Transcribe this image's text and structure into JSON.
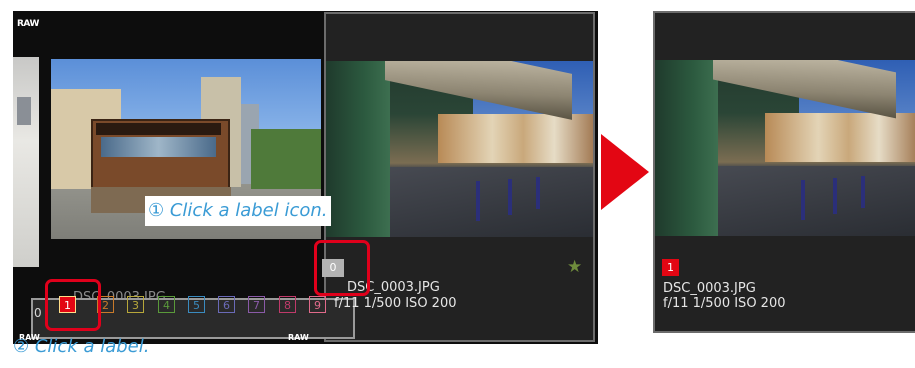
{
  "left_panel": {
    "raw_badge": "RAW",
    "behind_filename": "DSC_0003.JPG",
    "selected_thumb": {
      "label_icon": "0",
      "filename": "DSC_0003.JPG",
      "meta": "f/11 1/500  ISO 200",
      "star_icon": "star-icon"
    },
    "label_popup": {
      "labels": [
        "0",
        "1",
        "2",
        "3",
        "4",
        "5",
        "6",
        "7",
        "8",
        "9"
      ],
      "selected": "1",
      "raw_under": "RAW"
    }
  },
  "annotations": {
    "step1": "① Click a label icon.",
    "step2": "② Click a label."
  },
  "arrow": {
    "color": "#e30613"
  },
  "result": {
    "label_icon": "1",
    "filename": "DSC_0003.JPG",
    "meta": "f/11 1/500  ISO 200"
  },
  "colors": {
    "label_colors": {
      "0": "#d7d7d7",
      "1": "#e30613",
      "2": "#c87a2a",
      "3": "#b7a73a",
      "4": "#5a9a3a",
      "5": "#3a8bbf",
      "6": "#6a6ab8",
      "7": "#8a5aa8",
      "8": "#c03a6a",
      "9": "#e06a8a"
    },
    "highlight": "#e0001b",
    "annotation_text": "#3a9bd5"
  }
}
